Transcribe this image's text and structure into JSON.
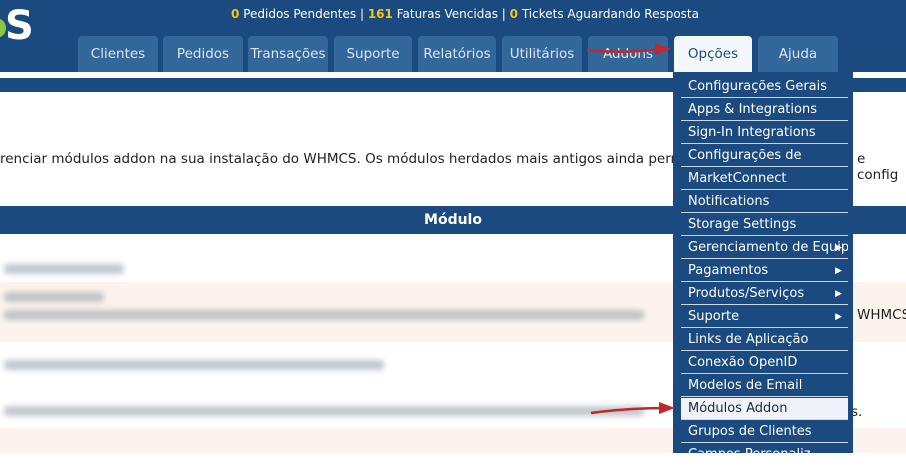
{
  "stats": {
    "pending_orders_count": "0",
    "pending_orders_label": "Pedidos Pendentes",
    "overdue_invoices_count": "161",
    "overdue_invoices_label": "Faturas Vencidas",
    "tickets_count": "0",
    "tickets_label": "Tickets Aguardando Resposta",
    "sep": "|"
  },
  "nav": {
    "tabs": [
      "Clientes",
      "Pedidos",
      "Transações",
      "Suporte",
      "Relatórios",
      "Utilitários",
      "Addons",
      "Opções",
      "Ajuda"
    ],
    "active": "Opções"
  },
  "page": {
    "description": "renciar módulos addon na sua instalação do WHMCS. Os módulos herdados mais antigos ainda permiti",
    "description_tail": "e config",
    "table_header": "Módulo",
    "row_right_1": "WHMCS",
    "row_right_2": "s."
  },
  "dropdown": {
    "items": [
      {
        "label": "Configurações Gerais",
        "submenu": false
      },
      {
        "label": "Apps & Integrations",
        "submenu": false
      },
      {
        "label": "Sign-In Integrations",
        "submenu": false
      },
      {
        "label": "Configurações de",
        "submenu": false
      },
      {
        "label": "MarketConnect",
        "submenu": false
      },
      {
        "label": "Notifications",
        "submenu": false
      },
      {
        "label": "Storage Settings",
        "submenu": false
      },
      {
        "label": "Gerenciamento de Equipe",
        "submenu": true
      },
      {
        "label": "Pagamentos",
        "submenu": true
      },
      {
        "label": "Produtos/Serviços",
        "submenu": true
      },
      {
        "label": "Suporte",
        "submenu": true
      },
      {
        "label": "Links de Aplicação",
        "submenu": false
      },
      {
        "label": "Conexão OpenID",
        "submenu": false
      },
      {
        "label": "Modelos de Email",
        "submenu": false
      },
      {
        "label": "Módulos Addon",
        "submenu": false,
        "highlighted": true
      },
      {
        "label": "Grupos de Clientes",
        "submenu": false
      },
      {
        "label": "Campos Personaliz",
        "submenu": false
      }
    ],
    "caret_glyph": "▶"
  },
  "colors": {
    "header_bg": "#1a4a80",
    "tab_bg": "#336699",
    "accent_yellow": "#f5c518",
    "annotation_arrow": "#c0282d"
  }
}
